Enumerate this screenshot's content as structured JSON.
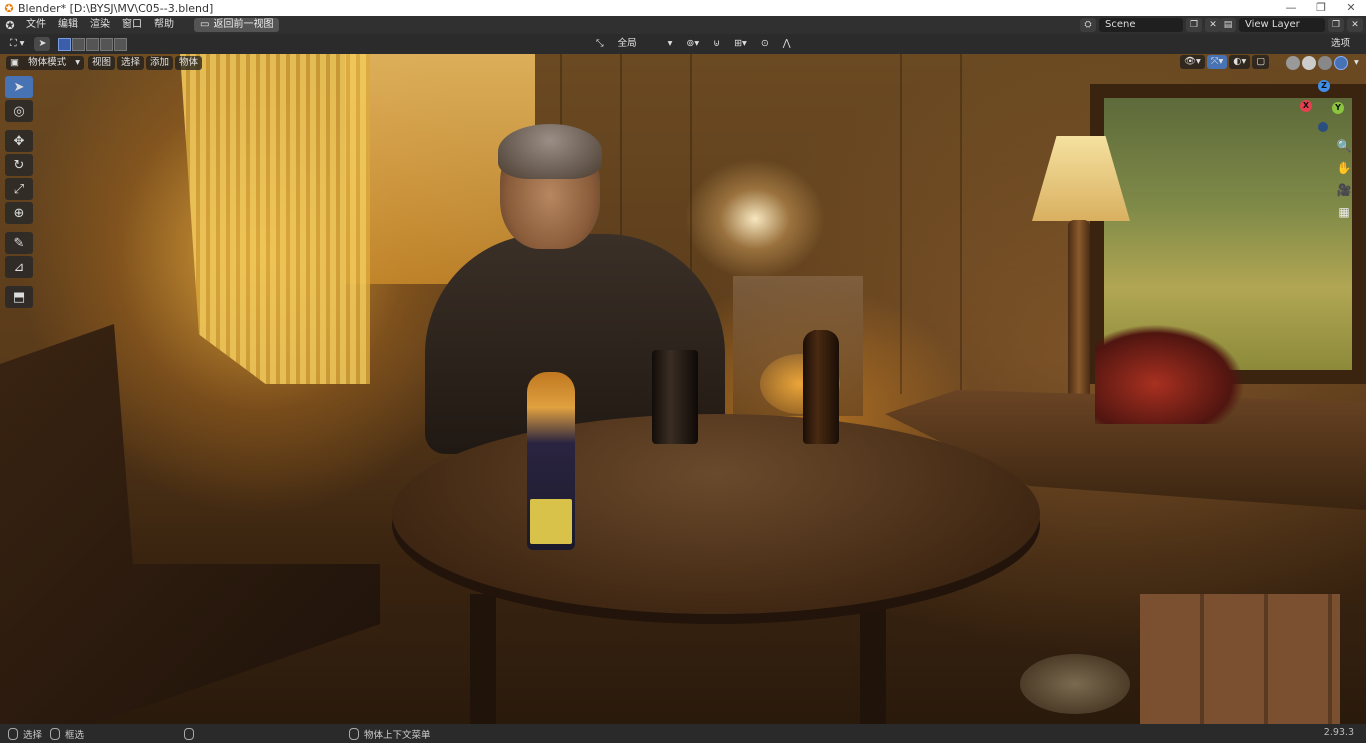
{
  "window": {
    "title": "Blender* [D:\\BYSJ\\MV\\C05--3.blend]",
    "controls": [
      "—",
      "❐",
      "✕"
    ]
  },
  "menubar": {
    "items": [
      "文件",
      "编辑",
      "渲染",
      "窗口",
      "帮助"
    ],
    "workspace_button": "返回前一视图",
    "scene_label": "Scene",
    "view_layer_label": "View Layer"
  },
  "viewport_header": {
    "transform_orientation": "全局",
    "options_label": "选项"
  },
  "viewport_header2": {
    "mode": "物体模式",
    "menus": [
      "视图",
      "选择",
      "添加",
      "物体"
    ]
  },
  "toolbar": {
    "tools": [
      {
        "name": "select-box",
        "glyph": "⬚",
        "active": true
      },
      {
        "name": "cursor",
        "glyph": "◎",
        "active": false
      },
      {
        "name": "move",
        "glyph": "✥",
        "active": false
      },
      {
        "name": "rotate",
        "glyph": "↻",
        "active": false
      },
      {
        "name": "scale",
        "glyph": "⤢",
        "active": false
      },
      {
        "name": "transform",
        "glyph": "⊕",
        "active": false
      },
      {
        "name": "annotate",
        "glyph": "✎",
        "active": false
      },
      {
        "name": "measure",
        "glyph": "📐",
        "active": false
      },
      {
        "name": "add-cube",
        "glyph": "⬒",
        "active": false
      }
    ]
  },
  "gizmo": {
    "axes": {
      "x": "X",
      "y": "Y",
      "z": "Z"
    },
    "colors": {
      "x": "#e5404f",
      "y": "#8bc53d",
      "z": "#3f8fe8"
    }
  },
  "statusbar": {
    "select": "选择",
    "box_select": "框选",
    "context_menu": "物体上下文菜单",
    "version": "2.93.3"
  }
}
